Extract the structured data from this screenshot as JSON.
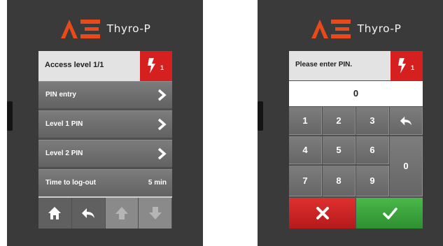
{
  "brand": {
    "name": "Thyro-P",
    "reg_mark": "®"
  },
  "colors": {
    "alert_red": "#d61f1f",
    "confirm_green": "#3aa83c",
    "accent_orange": "#e84a1a"
  },
  "menu_screen": {
    "header": {
      "title": "Access level 1/1",
      "badge_level": "1",
      "badge_icon": "lightning-icon"
    },
    "items": [
      {
        "label": "PIN entry",
        "icon": "chevron-right-icon"
      },
      {
        "label": "Level 1 PIN",
        "icon": "chevron-right-icon"
      },
      {
        "label": "Level 2 PIN",
        "icon": "chevron-right-icon"
      },
      {
        "label": "Time to log-out",
        "value": "5 min"
      }
    ],
    "toolbar": [
      {
        "icon": "home-icon",
        "enabled": true
      },
      {
        "icon": "back-arrow-icon",
        "enabled": true
      },
      {
        "icon": "arrow-up-icon",
        "enabled": false
      },
      {
        "icon": "arrow-down-icon",
        "enabled": false
      }
    ]
  },
  "pin_screen": {
    "header": {
      "title": "Please enter PIN.",
      "badge_level": "1",
      "badge_icon": "lightning-icon"
    },
    "display_value": "0",
    "keys": [
      "1",
      "2",
      "3",
      "4",
      "5",
      "6",
      "7",
      "8",
      "9",
      "0"
    ],
    "backspace_icon": "back-arrow-icon",
    "cancel_icon": "x-icon",
    "confirm_icon": "checkmark-icon"
  }
}
